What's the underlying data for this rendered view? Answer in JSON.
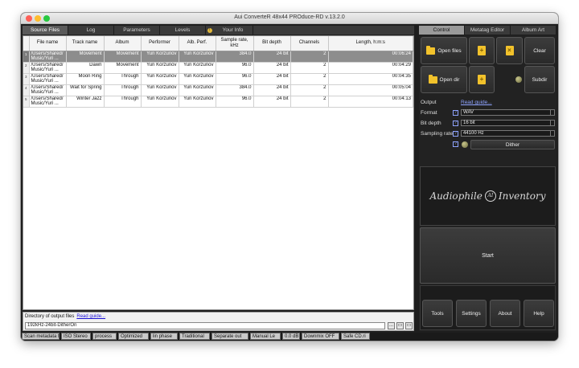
{
  "window": {
    "title": "Aui ConverteR 48x44 PROduce-RD v.13.2.0"
  },
  "left_tabs": [
    {
      "label": "Source Files",
      "active": true
    },
    {
      "label": "Log",
      "active": false
    },
    {
      "label": "Parameters",
      "active": false
    },
    {
      "label": "Levels",
      "active": false
    },
    {
      "label": "Your Info",
      "active": false
    }
  ],
  "table": {
    "headers": [
      "File name",
      "Track name",
      "Album",
      "Performer",
      "Alb. Perf.",
      "Sample rate, kHz",
      "Bit depth",
      "Channels",
      "Length, h:m:s"
    ],
    "rows": [
      {
        "idx": "1",
        "file": "/Users/Shared/ Music/Yuri ...",
        "track": "Movement",
        "album": "Movement",
        "performer": "Yuri Korzunov",
        "alb_perf": "Yuri Korzunov",
        "rate": "384.0",
        "bits": "24 bit",
        "channels": "2",
        "length": "00:06:24",
        "selected": true
      },
      {
        "idx": "2",
        "file": "/Users/Shared/ Music/Yuri ...",
        "track": "Dawn",
        "album": "Movement",
        "performer": "Yuri Korzunov",
        "alb_perf": "Yuri Korzunov",
        "rate": "96.0",
        "bits": "24 bit",
        "channels": "2",
        "length": "00:04:29",
        "selected": false
      },
      {
        "idx": "3",
        "file": "/Users/Shared/ Music/Yuri ...",
        "track": "Moon Ring",
        "album": "Through",
        "performer": "Yuri Korzunov",
        "alb_perf": "Yuri Korzunov",
        "rate": "96.0",
        "bits": "24 bit",
        "channels": "2",
        "length": "00:04:35",
        "selected": false
      },
      {
        "idx": "4",
        "file": "/Users/Shared/ Music/Yuri ...",
        "track": "Wait for Spring",
        "album": "Through",
        "performer": "Yuri Korzunov",
        "alb_perf": "Yuri Korzunov",
        "rate": "384.0",
        "bits": "24 bit",
        "channels": "2",
        "length": "00:05:04",
        "selected": false
      },
      {
        "idx": "5",
        "file": "/Users/Shared/ Music/Yuri ...",
        "track": "Winter Jazz",
        "album": "Through",
        "performer": "Yuri Korzunov",
        "alb_perf": "Yuri Korzunov",
        "rate": "96.0",
        "bits": "24 bit",
        "channels": "2",
        "length": "00:04:13",
        "selected": false
      }
    ]
  },
  "output_dir": {
    "label": "Directory of output files",
    "guide_link": "Read guide...",
    "value": "192kHz-24bit-DitherOn",
    "btn_dots": "...",
    "btn_a": "▭",
    "btn_b": "▭"
  },
  "status": [
    "Scan metadata f",
    "ISO Stereo",
    "process",
    "Optimized",
    "lin phase",
    "Traditional",
    "Separate out",
    "Manual Le",
    "0.0 dB",
    "Downmix OFF",
    "Safe CD.ri"
  ],
  "right_tabs": [
    {
      "label": "Control",
      "active": true
    },
    {
      "label": "Metatag Editor",
      "active": false
    },
    {
      "label": "Album Art",
      "active": false
    }
  ],
  "control": {
    "open_files": "Open files",
    "open_dir": "Open dir",
    "clear": "Clear",
    "subdir": "Subdir",
    "add_glyph": "+",
    "remove_glyph": "×",
    "output_label": "Output",
    "output_guide": "Read guide...",
    "format_label": "Format",
    "format_value": "WAV",
    "bitdepth_label": "Bit depth",
    "bitdepth_value": "16 bit",
    "rate_label": "Sampling rate",
    "rate_value": "44100 Hz",
    "help_glyph": "?",
    "dither": "Dither",
    "logo_left": "Audiophile",
    "logo_mark": "AI",
    "logo_right": "Inventory",
    "start": "Start",
    "tools": "Tools",
    "settings": "Settings",
    "about": "About",
    "help": "Help"
  },
  "colors": {
    "accent": "#f2c22b",
    "link": "#8fa4ff",
    "selected_row": "#8d8d8d"
  }
}
